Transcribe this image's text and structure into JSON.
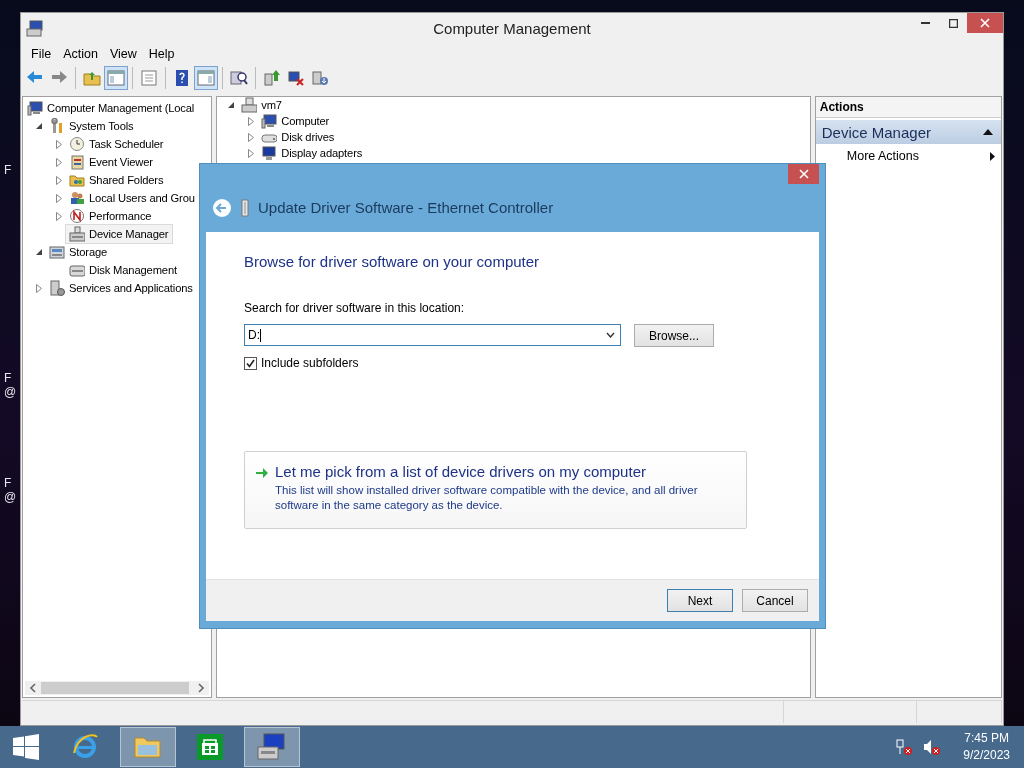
{
  "desktop": {
    "left_fragments": [
      {
        "text": "F"
      },
      {
        "text": "F"
      },
      {
        "text": "@"
      },
      {
        "text": "F"
      },
      {
        "text": "@"
      }
    ]
  },
  "window": {
    "title": "Computer Management",
    "menu": [
      "File",
      "Action",
      "View",
      "Help"
    ],
    "toolbar": [
      [
        {
          "pressed": false
        },
        {
          "pressed": false
        }
      ],
      [
        {
          "pressed": false
        },
        {
          "pressed": true
        }
      ],
      [
        {
          "pressed": false
        }
      ],
      [
        {
          "pressed": false
        },
        {
          "pressed": true
        }
      ],
      [
        {
          "pressed": false
        }
      ],
      [
        {
          "pressed": false
        },
        {
          "pressed": false
        },
        {
          "pressed": false
        }
      ]
    ],
    "left_tree": [
      {
        "label": "Computer Management (Local",
        "selected": false,
        "children": [
          {
            "label": "System Tools",
            "expanded": true,
            "selected": false,
            "children": [
              {
                "label": "Task Scheduler",
                "expanded": false,
                "selected": false
              },
              {
                "label": "Event Viewer",
                "expanded": false,
                "selected": false
              },
              {
                "label": "Shared Folders",
                "expanded": false,
                "selected": false
              },
              {
                "label": "Local Users and Grou",
                "expanded": false,
                "selected": false
              },
              {
                "label": "Performance",
                "expanded": false,
                "selected": false
              },
              {
                "label": "Device Manager",
                "selected": true
              }
            ]
          },
          {
            "label": "Storage",
            "expanded": true,
            "selected": false,
            "children": [
              {
                "label": "Disk Management",
                "selected": false
              }
            ]
          },
          {
            "label": "Services and Applications",
            "expanded": false,
            "selected": false
          }
        ]
      }
    ],
    "middle_tree": [
      {
        "label": "vm7",
        "expanded": true,
        "selected": false,
        "children": [
          {
            "label": "Computer",
            "expanded": false,
            "selected": false
          },
          {
            "label": "Disk drives",
            "expanded": false,
            "selected": false
          },
          {
            "label": "Display adapters",
            "expanded": false,
            "selected": false
          }
        ]
      }
    ],
    "actions": {
      "header": "Actions",
      "section": {
        "label": "Device Manager",
        "expanded": true
      },
      "items": [
        {
          "label": "More Actions"
        }
      ]
    }
  },
  "dialog": {
    "title": "Update Driver Software - Ethernet Controller",
    "heading": "Browse for driver software on your computer",
    "location_label": "Search for driver software in this location:",
    "location_value": "D:",
    "browse": "Browse...",
    "include_subfolders": {
      "label": "Include subfolders",
      "checked": true
    },
    "option": {
      "title": "Let me pick from a list of device drivers on my computer",
      "description": "This list will show installed driver software compatible with the device, and all driver software in the same category as the device."
    },
    "buttons": [
      {
        "label": "Next",
        "default": true
      },
      {
        "label": "Cancel",
        "default": false
      }
    ]
  },
  "taskbar": {
    "apps": [
      {
        "active": false
      },
      {
        "active": true
      },
      {
        "active": false
      },
      {
        "active": true
      }
    ],
    "clock": {
      "time": "7:45 PM",
      "date": "9/2/2023"
    }
  }
}
